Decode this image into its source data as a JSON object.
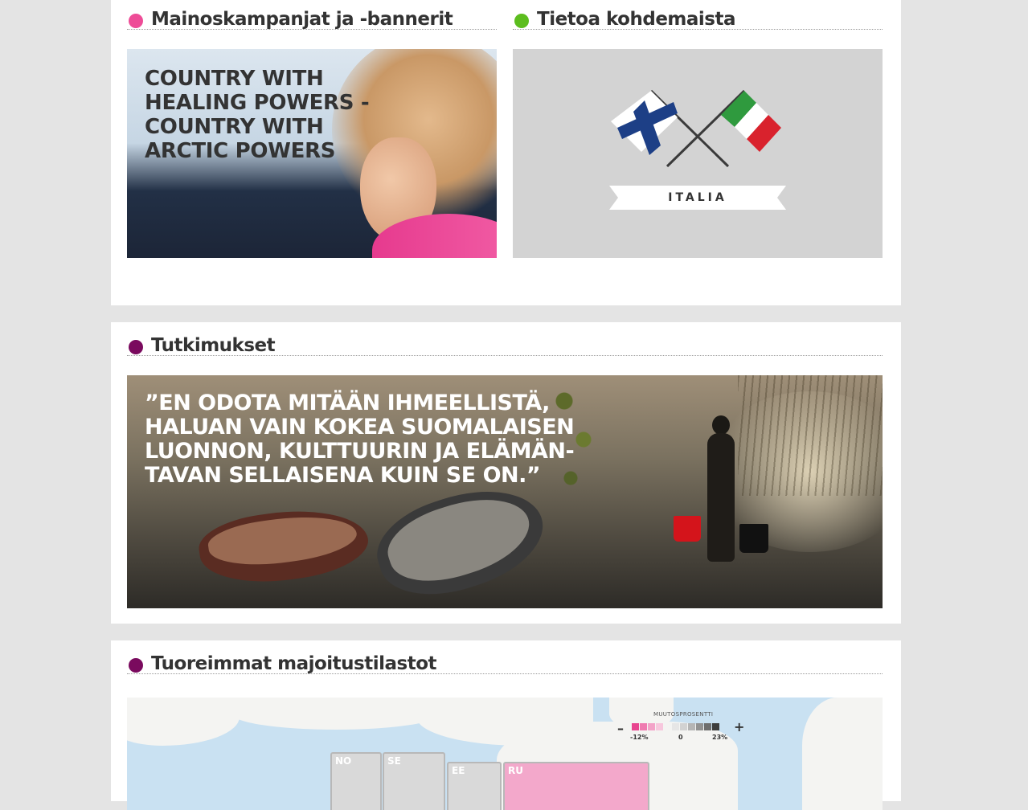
{
  "sections": {
    "campaigns": {
      "title": "Mainoskampanjat ja -bannerit",
      "dot_color": "#ee4c97",
      "banner_lines": [
        "COUNTRY WITH",
        "HEALING POWERS -",
        "COUNTRY WITH",
        "ARCTIC POWERS"
      ]
    },
    "destinations": {
      "title": "Tietoa kohdemaista",
      "dot_color": "#5cbd1e",
      "country_label": "ITALIA"
    },
    "research": {
      "title": "Tutkimukset",
      "dot_color": "#7a0a5e",
      "quote_lines": [
        "”EN ODOTA MITÄÄN IHMEELLISTÄ,",
        "HALUAN VAIN KOKEA SUOMALAISEN",
        "LUONNON, KULTTUURIN JA ELÄMÄN-",
        "TAVAN SELLAISENA KUIN SE ON.”"
      ]
    },
    "statistics": {
      "title": "Tuoreimmat majoitustilastot",
      "dot_color": "#7a0a5e",
      "legend": {
        "title": "MUUTOSPROSENTTI",
        "minus": "–",
        "plus": "+",
        "min_label": "-12%",
        "mid_label": "0",
        "max_label": "23%",
        "swatch_colors": [
          "#e8458f",
          "#ef7ab0",
          "#f3a2c8",
          "#f7c7dd",
          "#e6e6e6",
          "#d2d2d2",
          "#b5b5b5",
          "#929292",
          "#6e6e6e",
          "#3d3d3d"
        ]
      },
      "regions": [
        {
          "code": "NO",
          "color": "#d9d9d9"
        },
        {
          "code": "SE",
          "color": "#d9d9d9"
        },
        {
          "code": "EE",
          "color": "#d9d9d9"
        },
        {
          "code": "RU",
          "color": "#f3a8cb"
        }
      ]
    }
  },
  "flags": {
    "finland": {
      "blue": "#1d3f86",
      "white": "#ffffff"
    },
    "italy": {
      "green": "#2f9a3e",
      "white": "#ffffff",
      "red": "#d9222d"
    }
  }
}
